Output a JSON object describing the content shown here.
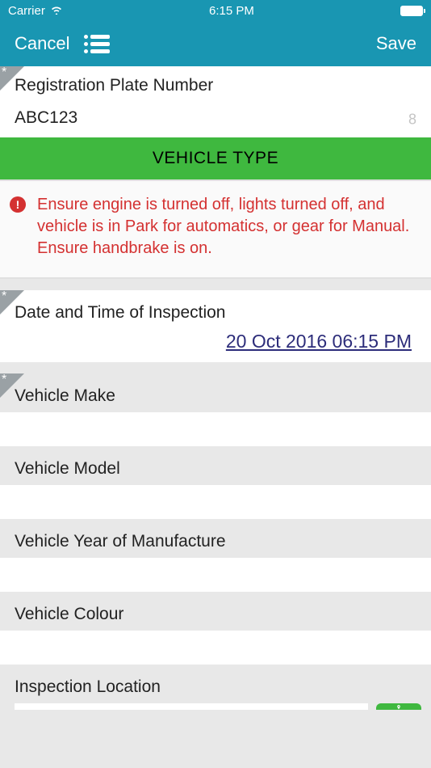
{
  "status": {
    "carrier": "Carrier",
    "time": "6:15 PM"
  },
  "nav": {
    "cancel": "Cancel",
    "save": "Save"
  },
  "fields": {
    "registration": {
      "label": "Registration Plate Number",
      "value": "ABC123",
      "counter": "8"
    },
    "dateInspection": {
      "label": "Date and Time of Inspection",
      "value": "20 Oct 2016 06:15 PM"
    },
    "make": {
      "label": "Vehicle Make"
    },
    "model": {
      "label": "Vehicle Model"
    },
    "year": {
      "label": "Vehicle Year of Manufacture"
    },
    "colour": {
      "label": "Vehicle Colour"
    },
    "location": {
      "label": "Inspection Location"
    }
  },
  "section": {
    "vehicleType": "VEHICLE TYPE"
  },
  "warning": {
    "text": "Ensure engine is turned off, lights turned off, and vehicle is in Park for automatics, or gear for Manual. Ensure handbrake is on."
  }
}
